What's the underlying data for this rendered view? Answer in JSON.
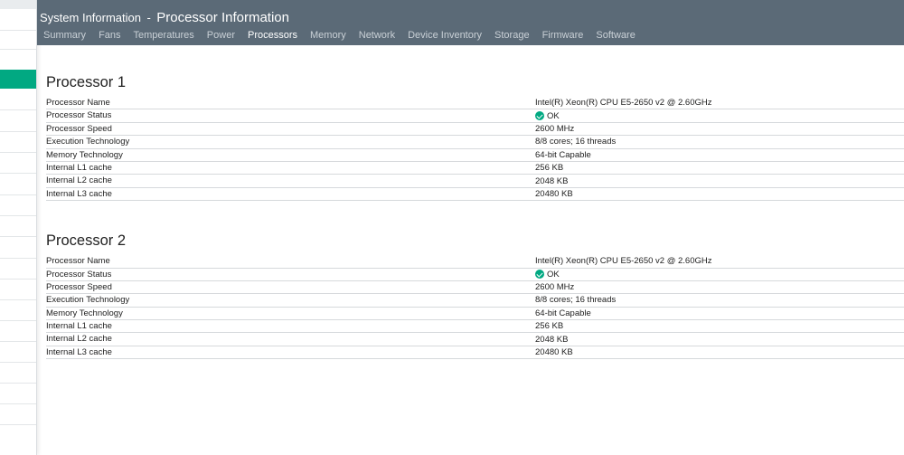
{
  "header": {
    "prefix": "System Information",
    "separator": "-",
    "title": "Processor Information",
    "tabs": [
      {
        "label": "Summary"
      },
      {
        "label": "Fans"
      },
      {
        "label": "Temperatures"
      },
      {
        "label": "Power"
      },
      {
        "label": "Processors",
        "active": true
      },
      {
        "label": "Memory"
      },
      {
        "label": "Network"
      },
      {
        "label": "Device Inventory"
      },
      {
        "label": "Storage"
      },
      {
        "label": "Firmware"
      },
      {
        "label": "Software"
      }
    ]
  },
  "colors": {
    "header_bg": "#5b6a77",
    "accent": "#01a982",
    "status_ok": "#01a982"
  },
  "processors": [
    {
      "title": "Processor 1",
      "rows": [
        {
          "label": "Processor Name",
          "value": "Intel(R) Xeon(R) CPU E5-2650 v2 @ 2.60GHz"
        },
        {
          "label": "Processor Status",
          "value": "OK",
          "icon": "ok-check-icon"
        },
        {
          "label": "Processor Speed",
          "value": "2600 MHz"
        },
        {
          "label": "Execution Technology",
          "value": "8/8 cores; 16 threads"
        },
        {
          "label": "Memory Technology",
          "value": "64-bit Capable"
        },
        {
          "label": "Internal L1 cache",
          "value": "256 KB"
        },
        {
          "label": "Internal L2 cache",
          "value": "2048 KB"
        },
        {
          "label": "Internal L3 cache",
          "value": "20480 KB"
        }
      ]
    },
    {
      "title": "Processor 2",
      "rows": [
        {
          "label": "Processor Name",
          "value": "Intel(R) Xeon(R) CPU E5-2650 v2 @ 2.60GHz"
        },
        {
          "label": "Processor Status",
          "value": "OK",
          "icon": "ok-check-icon"
        },
        {
          "label": "Processor Speed",
          "value": "2600 MHz"
        },
        {
          "label": "Execution Technology",
          "value": "8/8 cores; 16 threads"
        },
        {
          "label": "Memory Technology",
          "value": "64-bit Capable"
        },
        {
          "label": "Internal L1 cache",
          "value": "256 KB"
        },
        {
          "label": "Internal L2 cache",
          "value": "2048 KB"
        },
        {
          "label": "Internal L3 cache",
          "value": "20480 KB"
        }
      ]
    }
  ]
}
